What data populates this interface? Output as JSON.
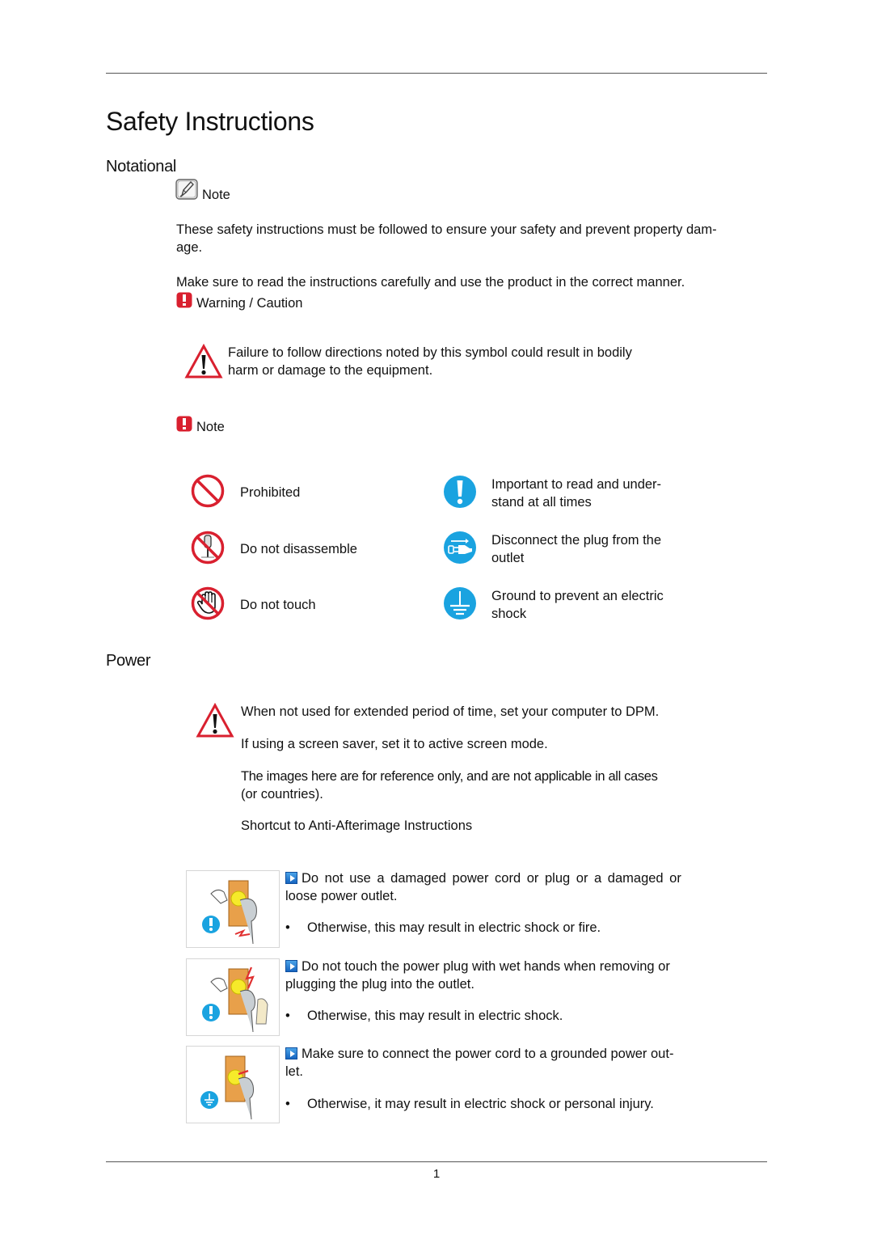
{
  "page": {
    "title": "Safety Instructions",
    "page_number": "1"
  },
  "notational": {
    "heading": "Notational",
    "note_label": "Note",
    "paragraphs": [
      "These safety instructions must be followed to ensure your safety and prevent property dam-\nage.",
      "Make sure to read the instructions carefully and use the product in the correct manner."
    ],
    "warning_label": "Warning / Caution",
    "warning_text_line1": "Failure to follow directions noted by this symbol could result in bodily",
    "warning_text_line2": "harm or damage to the equipment.",
    "note2_label": "Note",
    "symbols": [
      {
        "icon": "prohibited-icon",
        "label": "Prohibited"
      },
      {
        "icon": "do-not-disassemble-icon",
        "label": "Do not disassemble"
      },
      {
        "icon": "do-not-touch-icon",
        "label": "Do not touch"
      },
      {
        "icon": "important-icon",
        "label_line1": "Important to read and under-",
        "label_line2": "stand at all times"
      },
      {
        "icon": "disconnect-plug-icon",
        "label_line1": "Disconnect the plug from the",
        "label_line2": "outlet"
      },
      {
        "icon": "ground-icon",
        "label_line1": "Ground to prevent an electric",
        "label_line2": "shock"
      }
    ]
  },
  "power": {
    "heading": "Power",
    "intro": [
      "When not used for extended period of time, set your computer to DPM.",
      "If using a screen saver, set it to active screen mode.",
      "The images here are for reference only, and are not applicable in all cases",
      "(or countries).",
      "Shortcut to Anti-Afterimage Instructions"
    ],
    "items": [
      {
        "line1": "Do not use a damaged power cord or plug or a damaged or",
        "line2": "loose power outlet.",
        "bullet": "Otherwise, this may result in electric shock or fire.",
        "badge": "important-icon"
      },
      {
        "line1": "Do not touch the power plug with wet hands when removing or",
        "line2": "plugging the plug into the outlet.",
        "bullet": "Otherwise, this may result in electric shock.",
        "badge": "important-icon"
      },
      {
        "line1": "Make sure to connect the power cord to a grounded power out-",
        "line2": "let.",
        "bullet": "Otherwise, it may result in electric shock or personal injury.",
        "badge": "ground-icon"
      }
    ]
  },
  "colors": {
    "warning_red": "#d9202f",
    "info_blue": "#1aa3e0",
    "rule": "#555555"
  }
}
